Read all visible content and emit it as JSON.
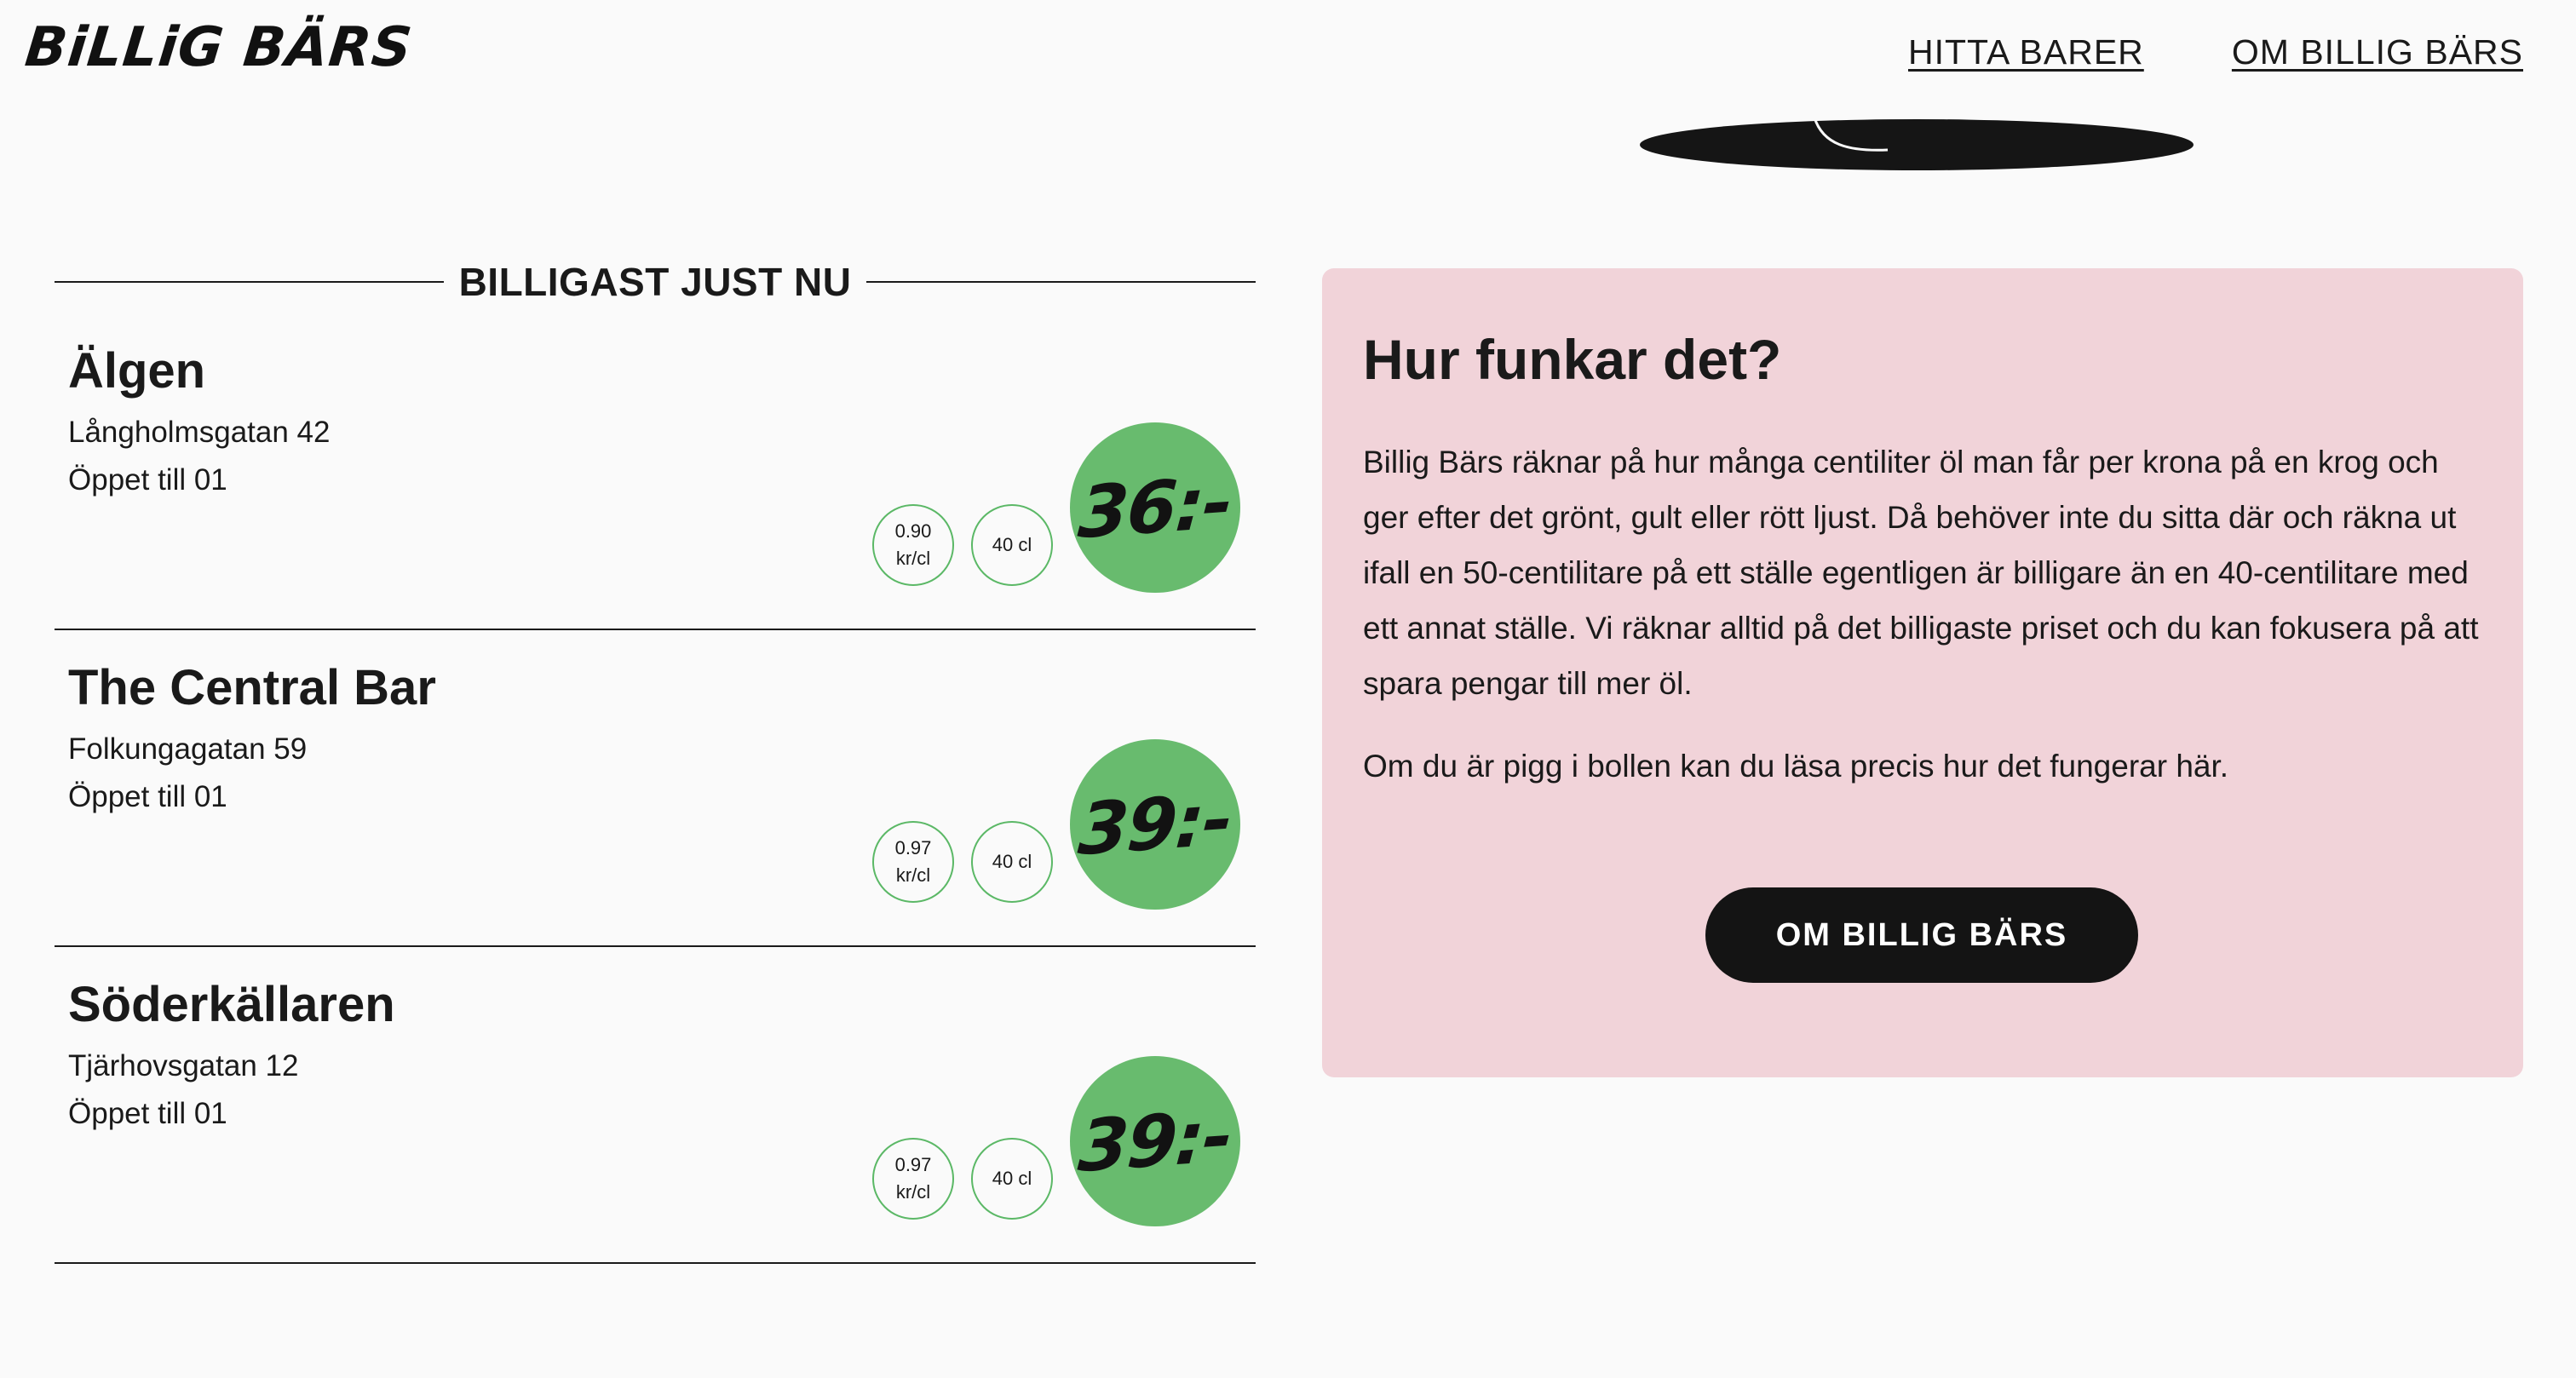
{
  "header": {
    "logo_text": "BiLLiG BÄRS",
    "nav": [
      {
        "label": "HITTA BARER"
      },
      {
        "label": "OM BILLIG BÄRS"
      }
    ]
  },
  "section": {
    "title": "BILLIGAST JUST NU"
  },
  "bars": [
    {
      "name": "Älgen",
      "address": "Långholmsgatan 42",
      "hours": "Öppet till 01",
      "rate_value": "0.90",
      "rate_unit": "kr/cl",
      "size": "40 cl",
      "price": "36:-"
    },
    {
      "name": "The Central Bar",
      "address": "Folkungagatan 59",
      "hours": "Öppet till 01",
      "rate_value": "0.97",
      "rate_unit": "kr/cl",
      "size": "40 cl",
      "price": "39:-"
    },
    {
      "name": "Söderkällaren",
      "address": "Tjärhovsgatan 12",
      "hours": "Öppet till 01",
      "rate_value": "0.97",
      "rate_unit": "kr/cl",
      "size": "40 cl",
      "price": "39:-"
    }
  ],
  "info": {
    "title": "Hur funkar det?",
    "paragraph1": "Billig Bärs räknar på hur många centiliter öl man får per krona på en krog och ger efter det grönt, gult eller rött ljust. Då behöver inte du sitta där och räkna ut ifall en 50-centilitare på ett ställe egentligen är billigare än en 40-centilitare med ett annat ställe. Vi räknar alltid på det billigaste priset och du kan fokusera på att spara pengar till mer öl.",
    "paragraph2": "Om du är pigg i bollen kan du läsa precis hur det fungerar här.",
    "button_label": "OM BILLIG BÄRS"
  },
  "colors": {
    "background": "#fafafa",
    "price_badge": "#68bb6e",
    "chip_border": "#5bb866",
    "info_card": "#f1d3d9",
    "button": "#141414"
  },
  "icons": {
    "decor": "beer-glass-shadow-icon"
  }
}
